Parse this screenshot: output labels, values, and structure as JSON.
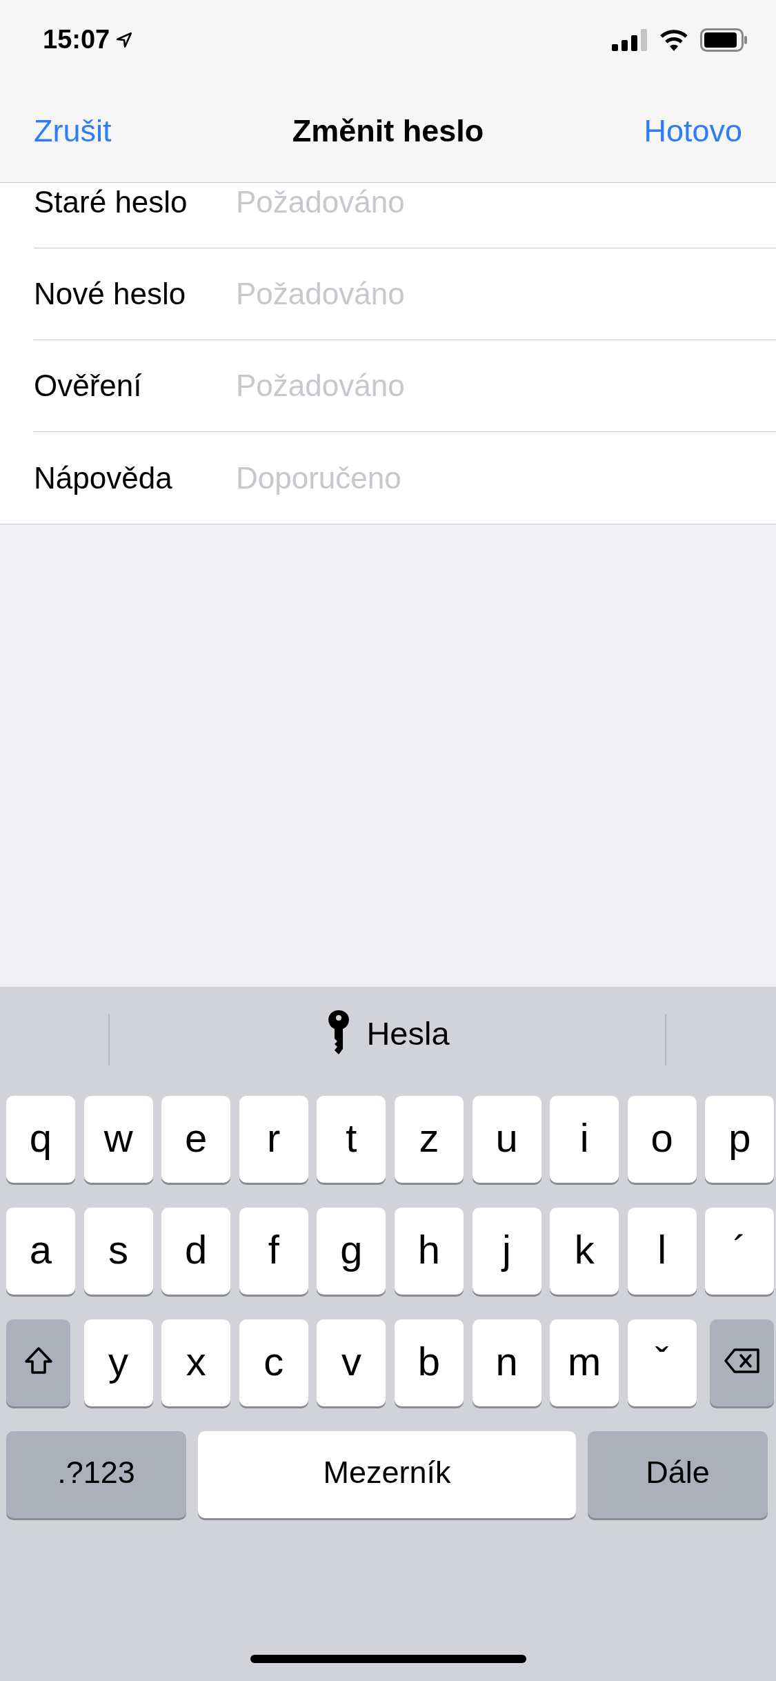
{
  "status_bar": {
    "time": "15:07"
  },
  "nav": {
    "cancel": "Zrušit",
    "title": "Změnit heslo",
    "done": "Hotovo"
  },
  "fields": [
    {
      "label": "Staré heslo",
      "placeholder": "Požadováno"
    },
    {
      "label": "Nové heslo",
      "placeholder": "Požadováno"
    },
    {
      "label": "Ověření",
      "placeholder": "Požadováno"
    },
    {
      "label": "Nápověda",
      "placeholder": "Doporučeno"
    }
  ],
  "keyboard": {
    "suggestion": "Hesla",
    "rows": [
      [
        {
          "kind": "letter",
          "label": "q"
        },
        {
          "kind": "letter",
          "label": "w"
        },
        {
          "kind": "letter",
          "label": "e"
        },
        {
          "kind": "letter",
          "label": "r"
        },
        {
          "kind": "letter",
          "label": "t"
        },
        {
          "kind": "letter",
          "label": "z"
        },
        {
          "kind": "letter",
          "label": "u"
        },
        {
          "kind": "letter",
          "label": "i"
        },
        {
          "kind": "letter",
          "label": "o"
        },
        {
          "kind": "letter",
          "label": "p"
        }
      ],
      [
        {
          "kind": "letter",
          "label": "a"
        },
        {
          "kind": "letter",
          "label": "s"
        },
        {
          "kind": "letter",
          "label": "d"
        },
        {
          "kind": "letter",
          "label": "f"
        },
        {
          "kind": "letter",
          "label": "g"
        },
        {
          "kind": "letter",
          "label": "h"
        },
        {
          "kind": "letter",
          "label": "j"
        },
        {
          "kind": "letter",
          "label": "k"
        },
        {
          "kind": "letter",
          "label": "l"
        },
        {
          "kind": "letter",
          "label": "´"
        }
      ],
      [
        {
          "kind": "shift"
        },
        {
          "kind": "letter",
          "label": "y"
        },
        {
          "kind": "letter",
          "label": "x"
        },
        {
          "kind": "letter",
          "label": "c"
        },
        {
          "kind": "letter",
          "label": "v"
        },
        {
          "kind": "letter",
          "label": "b"
        },
        {
          "kind": "letter",
          "label": "n"
        },
        {
          "kind": "letter",
          "label": "m"
        },
        {
          "kind": "letter",
          "label": "ˇ"
        },
        {
          "kind": "backspace"
        }
      ]
    ],
    "bottom_keys": [
      {
        "kind": "function",
        "label": ".?123"
      },
      {
        "kind": "space",
        "label": "Mezerník"
      },
      {
        "kind": "function",
        "label": "Dále"
      }
    ]
  }
}
